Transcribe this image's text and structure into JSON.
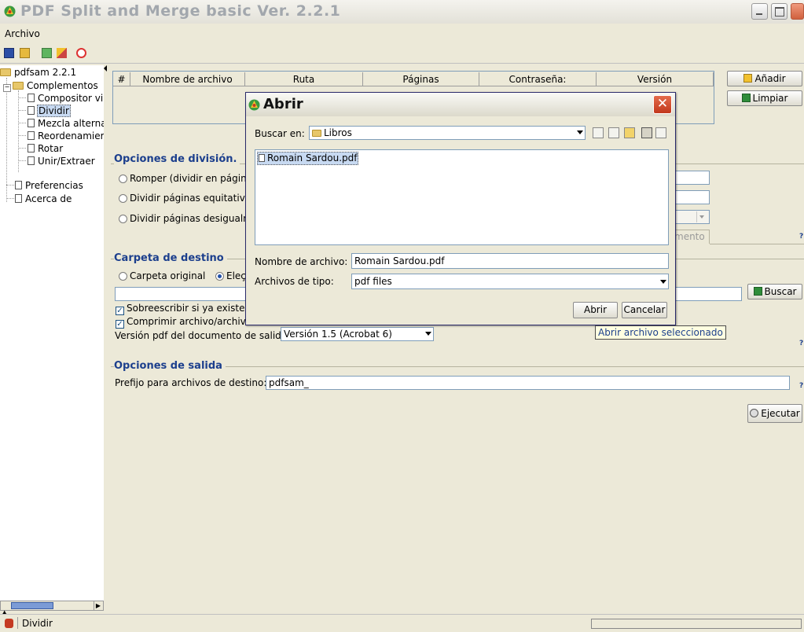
{
  "window": {
    "title": "PDF Split and Merge basic Ver. 2.2.1"
  },
  "menu": {
    "archivo": "Archivo"
  },
  "tree": {
    "root": "pdfsam 2.2.1",
    "complementos": "Complementos",
    "items": [
      "Compositor vi",
      "Dividir",
      "Mezcla alterna",
      "Reordenamier",
      "Rotar",
      "Unir/Extraer"
    ],
    "preferencias": "Preferencias",
    "acerca": "Acerca de"
  },
  "table": {
    "headers": [
      "#",
      "Nombre de archivo",
      "Ruta",
      "Páginas",
      "Contraseña:",
      "Versión"
    ]
  },
  "buttons": {
    "anadir": "Añadir",
    "limpiar": "Limpiar",
    "buscar": "Buscar",
    "ejecutar": "Ejecutar"
  },
  "division": {
    "title": "Opciones de división.",
    "options": [
      "Romper (dividir en págin",
      "Dividir páginas equitativa",
      "Dividir páginas desigualm"
    ],
    "tab_fragment": "mento"
  },
  "destino": {
    "title": "Carpeta de destino",
    "radio_original": "Carpeta original",
    "radio_elegir": "Eleç",
    "sobrescribir": "Sobreescribir si ya existe",
    "comprimir": "Comprimir archivo/archivo",
    "version_label": "Versión pdf del documento de salida",
    "version_value": "Versión 1.5 (Acrobat 6)"
  },
  "salida": {
    "title": "Opciones de salida",
    "prefijo_label": "Prefijo para archivos de destino:",
    "prefijo_value": "pdfsam_"
  },
  "dialog": {
    "title": "Abrir",
    "buscar_en_label": "Buscar en:",
    "folder": "Libros",
    "files": [
      "Romain Sardou.pdf"
    ],
    "nombre_label": "Nombre de archivo:",
    "nombre_value": "Romain Sardou.pdf",
    "tipo_label": "Archivos de tipo:",
    "tipo_value": "pdf files",
    "abrir": "Abrir",
    "cancelar": "Cancelar"
  },
  "tooltip": "Abrir archivo seleccionado",
  "status": {
    "text": "Dividir"
  },
  "colors": {
    "section_title": "#1c3f8d",
    "selection": "#c7d9f1",
    "close_red": "#d24a2a"
  }
}
